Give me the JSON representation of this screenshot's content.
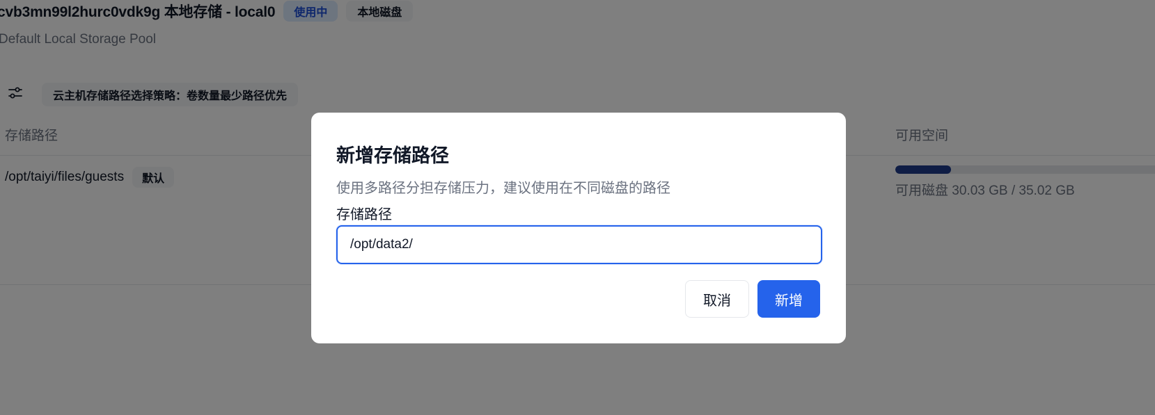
{
  "storage_pool": {
    "title": "cvb3mn99l2hurc0vdk9g 本地存储 - local0",
    "status_badge": "使用中",
    "type_badge": "本地磁盘",
    "description": "Default Local Storage Pool"
  },
  "toolbar": {
    "settings_icon": "sliders-icon",
    "strategy_label": "云主机存储路径选择策略：卷数量最少路径优先"
  },
  "table": {
    "columns": {
      "path": "存储路径",
      "available_space": "可用空间"
    },
    "rows": [
      {
        "path": "/opt/taiyi/files/guests",
        "default_badge": "默认",
        "usage_text": "可用磁盘 30.03 GB / 35.02 GB",
        "usage_fraction": 0.2
      }
    ]
  },
  "colors": {
    "primary": "#2563eb",
    "progress_fill": "#1e3a8a",
    "overlay": "rgba(0,0,0,0.5)"
  },
  "modal": {
    "title": "新增存储路径",
    "description": "使用多路径分担存储压力，建议使用在不同磁盘的路径",
    "field_label": "存储路径",
    "input_value": "/opt/data2/",
    "cancel_label": "取消",
    "submit_label": "新增"
  }
}
